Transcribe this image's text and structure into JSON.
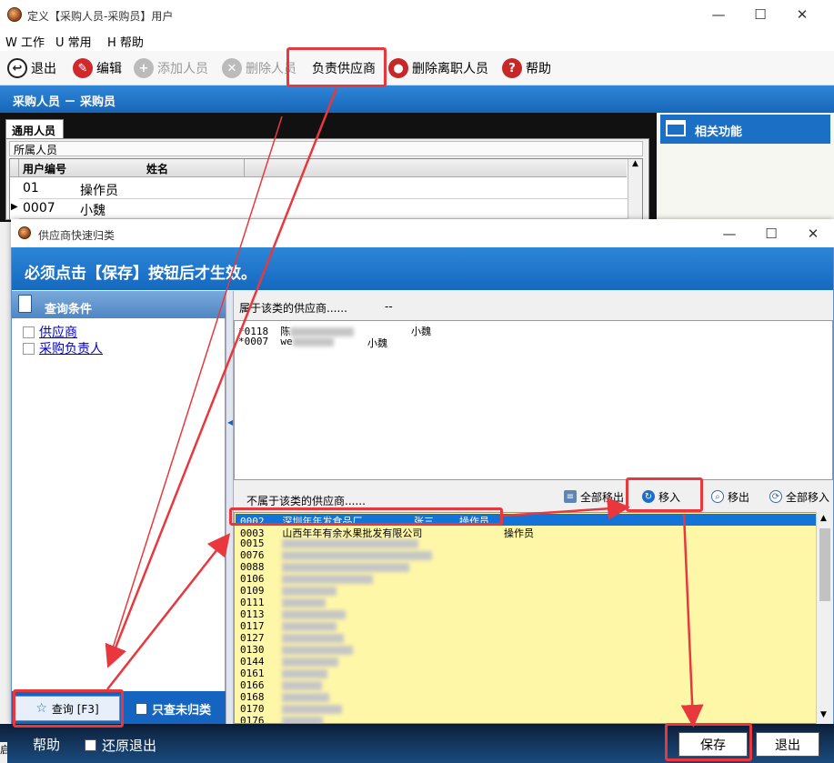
{
  "main": {
    "title": "定义【采购人员-采购员】用户",
    "menu": [
      "W 工作",
      "U 常用",
      "H 帮助"
    ],
    "toolbar": {
      "exit": "退出",
      "edit": "编辑",
      "add_staff": "添加人员",
      "delete_staff": "删除人员",
      "responsible_supplier": "负责供应商",
      "delete_departed": "删除离职人员",
      "help": "帮助"
    },
    "breadcrumb": "采购人员 － 采购员",
    "tab": "通用人员",
    "group_label": "所属人员",
    "grid_headers": [
      "用户编号",
      "姓名"
    ],
    "rows": [
      {
        "id": "01",
        "name": "操作员"
      },
      {
        "id": "0007",
        "name": "小魏"
      }
    ],
    "related": "相关功能",
    "bottom": {
      "help": "帮助",
      "restore_exit": "还原退出",
      "left_stub": "启"
    }
  },
  "dialog": {
    "title": "供应商快速归类",
    "banner": "必须点击【保存】按钮后才生效。",
    "query_head": "查询条件",
    "conditions": [
      "供应商",
      "采购负责人"
    ],
    "belong_label": "属于该类的供应商......",
    "belong_sep": "--",
    "belong_rows": [
      {
        "star": "*",
        "code": "0118",
        "name_start": "陈",
        "person": "小魏"
      },
      {
        "star": "*",
        "code": "0007",
        "name_start": "we",
        "person": "小魏"
      }
    ],
    "notbelong_label": "不属于该类的供应商......",
    "actions": {
      "move_out_all": "全部移出",
      "move_in": "移入",
      "move_out": "移出",
      "move_in_all": "全部移入"
    },
    "suppliers": [
      {
        "code": "0002",
        "name": "深圳年年发食品厂",
        "person": "张三",
        "role": "操作员"
      },
      {
        "code": "0003",
        "name": "山西年年有余水果批发有限公司",
        "person": "",
        "role": "操作员"
      },
      {
        "code": "0015"
      },
      {
        "code": "0076"
      },
      {
        "code": "0088"
      },
      {
        "code": "0106"
      },
      {
        "code": "0109"
      },
      {
        "code": "0111"
      },
      {
        "code": "0113"
      },
      {
        "code": "0117"
      },
      {
        "code": "0127"
      },
      {
        "code": "0130"
      },
      {
        "code": "0144"
      },
      {
        "code": "0161"
      },
      {
        "code": "0166"
      },
      {
        "code": "0168"
      },
      {
        "code": "0170"
      },
      {
        "code": "0176"
      }
    ],
    "query_button": "查询 [F3]",
    "unclassified_only": "只查未归类",
    "save": "保存",
    "exit": "退出"
  },
  "colors": {
    "accent": "#1565c0",
    "highlight": "#e8383d",
    "list_bg": "#fff7a8"
  }
}
